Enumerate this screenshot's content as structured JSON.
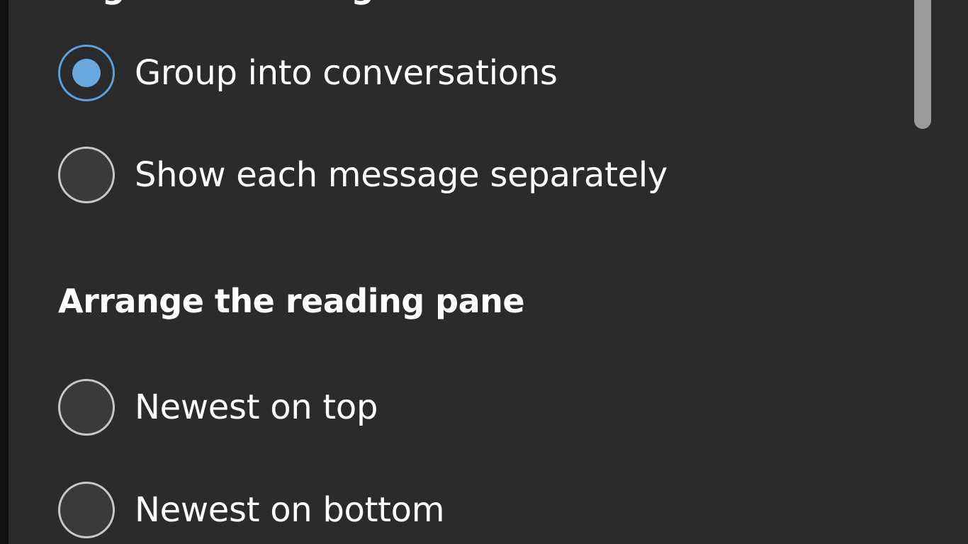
{
  "settings": {
    "partial_heading": "Organize messages",
    "conversation_options": [
      {
        "label": "Group into conversations",
        "selected": true
      },
      {
        "label": "Show each message separately",
        "selected": false
      }
    ],
    "reading_pane": {
      "heading": "Arrange the reading pane",
      "options": [
        {
          "label": "Newest on top",
          "selected": false
        },
        {
          "label": "Newest on bottom",
          "selected": false
        }
      ]
    }
  },
  "colors": {
    "panel_background": "#2b2b2b",
    "accent": "#5ea0dc",
    "text": "#ffffff"
  }
}
